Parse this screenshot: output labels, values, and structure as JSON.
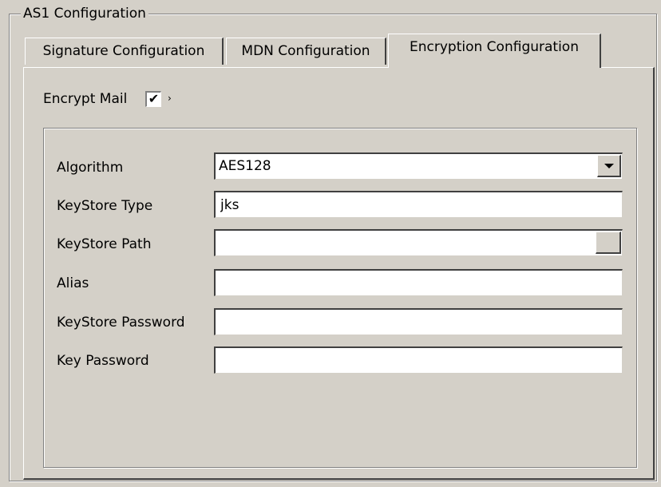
{
  "group": {
    "title": "AS1 Configuration"
  },
  "tabs": [
    {
      "label": "Signature Configuration",
      "active": false
    },
    {
      "label": "MDN Configuration",
      "active": false
    },
    {
      "label": "Encryption Configuration",
      "active": true
    }
  ],
  "encryption": {
    "encrypt_mail_label": "Encrypt Mail",
    "encrypt_mail_checked": true,
    "checkmark": "✔",
    "arrow": "›",
    "fields": {
      "algorithm": {
        "label": "Algorithm",
        "value": "AES128"
      },
      "keystore_type": {
        "label": "KeyStore Type",
        "value": "jks"
      },
      "keystore_path": {
        "label": "KeyStore Path",
        "value": ""
      },
      "alias": {
        "label": "Alias",
        "value": ""
      },
      "keystore_password": {
        "label": "KeyStore Password",
        "value": ""
      },
      "key_password": {
        "label": "Key Password",
        "value": ""
      }
    }
  }
}
